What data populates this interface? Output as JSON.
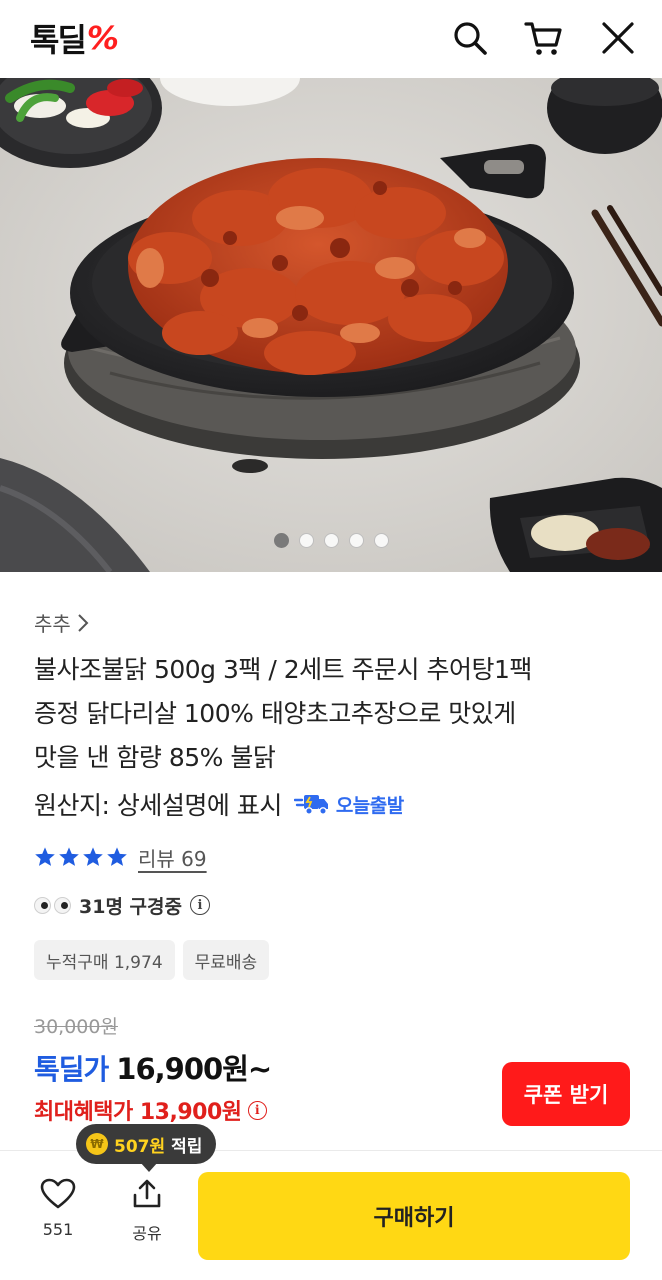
{
  "header": {
    "logo_text": "톡딜",
    "logo_mark": "%",
    "icons": [
      "search-icon",
      "cart-icon",
      "close-icon"
    ]
  },
  "gallery": {
    "image_count": 5,
    "active_index": 0
  },
  "product": {
    "seller": "추추",
    "title_lines": [
      "불사조불닭 500g 3팩 / 2세트 주문시 추어탕1팩",
      "증정 닭다리살 100% 태양초고추장으로 맛있게",
      "맛을 낸 함량 85% 불닭"
    ],
    "origin": "원산지: 상세설명에 표시",
    "shipping_badge": "오늘출발",
    "rating_stars": 4,
    "review_label": "리뷰 69",
    "viewers": "31명 구경중",
    "chips": [
      "누적구매 1,974",
      "무료배송"
    ]
  },
  "price": {
    "original": "30,000원",
    "deal_label": "톡딜가",
    "deal_price": "16,900원~",
    "max_benefit": "최대혜택가 13,900원",
    "coupon_button": "쿠폰 받기"
  },
  "bottom_bar": {
    "points_amount": "507원",
    "points_suffix": "적립",
    "like_count": "551",
    "share_label": "공유",
    "buy_button": "구매하기"
  },
  "colors": {
    "brand_red": "#ff1a1a",
    "deal_blue": "#1f5ce0",
    "benefit_red": "#e0201c",
    "buy_yellow": "#ffd814"
  }
}
